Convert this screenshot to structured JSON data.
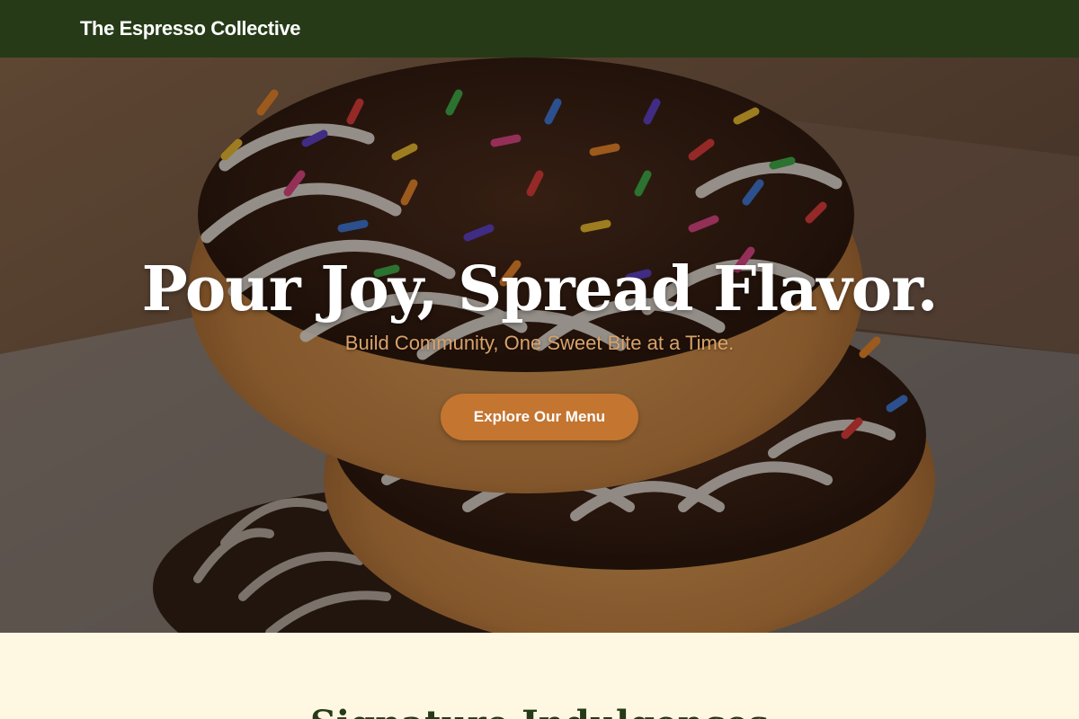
{
  "header": {
    "brand": "The Espresso Collective"
  },
  "hero": {
    "image": "donut-stack-photo",
    "title": "Pour Joy, Spread Flavor.",
    "subtitle": "Build Community, One Sweet Bite at a Time.",
    "cta_label": "Explore Our Menu"
  },
  "section": {
    "heading": "Signature Indulgences"
  },
  "colors": {
    "header_bg": "#263a17",
    "cta_bg": "#c47530",
    "subtitle": "#d9a26a",
    "section_bg": "#fef7e1"
  }
}
